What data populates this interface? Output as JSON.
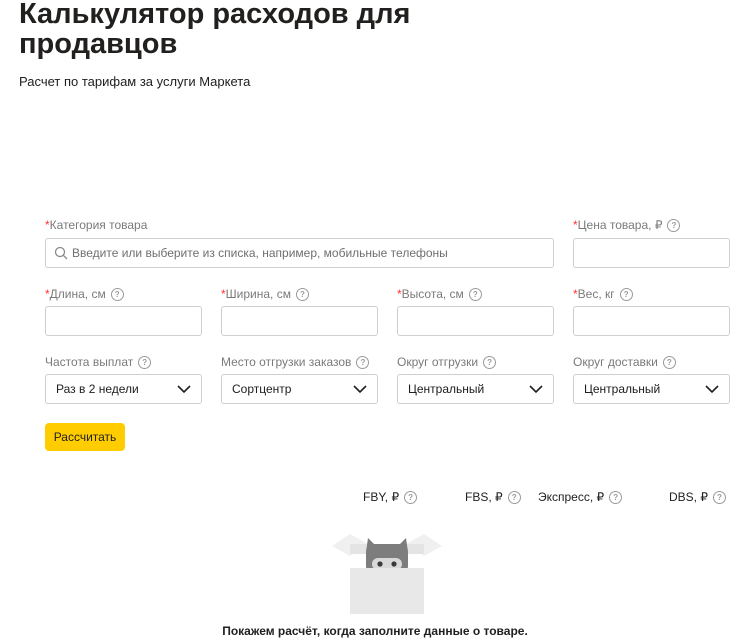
{
  "header": {
    "title": "Калькулятор расходов для продавцов",
    "subtitle": "Расчет по тарифам за услуги Маркета"
  },
  "form": {
    "category": {
      "required_mark": "*",
      "label": "Категория товара",
      "placeholder": "Введите или выберите из списка, например, мобильные телефоны",
      "value": ""
    },
    "price": {
      "required_mark": "*",
      "label": "Цена товара, ₽",
      "value": ""
    },
    "length": {
      "required_mark": "*",
      "label": "Длина, см",
      "value": ""
    },
    "width": {
      "required_mark": "*",
      "label": "Ширина, см",
      "value": ""
    },
    "height": {
      "required_mark": "*",
      "label": "Высота, см",
      "value": ""
    },
    "weight": {
      "required_mark": "*",
      "label": "Вес, кг",
      "value": ""
    },
    "payout_frequency": {
      "label": "Частота выплат",
      "value": "Раз в 2 недели"
    },
    "shipment_place": {
      "label": "Место отгрузки заказов",
      "value": "Сортцентр"
    },
    "shipment_district": {
      "label": "Округ отгрузки",
      "value": "Центральный"
    },
    "delivery_district": {
      "label": "Округ доставки",
      "value": "Центральный"
    },
    "calculate_button": "Рассчитать"
  },
  "results": {
    "columns": [
      "FBY, ₽",
      "FBS, ₽",
      "Экспресс, ₽",
      "DBS, ₽"
    ],
    "empty_message": "Покажем расчёт, когда заполните данные о товаре."
  },
  "icons": {
    "help": "question-circle-icon",
    "search": "search-icon",
    "dropdown": "chevron-down-icon",
    "illustration": "empty-box-illustration"
  },
  "colors": {
    "accent": "#ffcc00",
    "required": "#ff3333",
    "border": "#cfcfcf",
    "label": "#7a7a7a"
  }
}
